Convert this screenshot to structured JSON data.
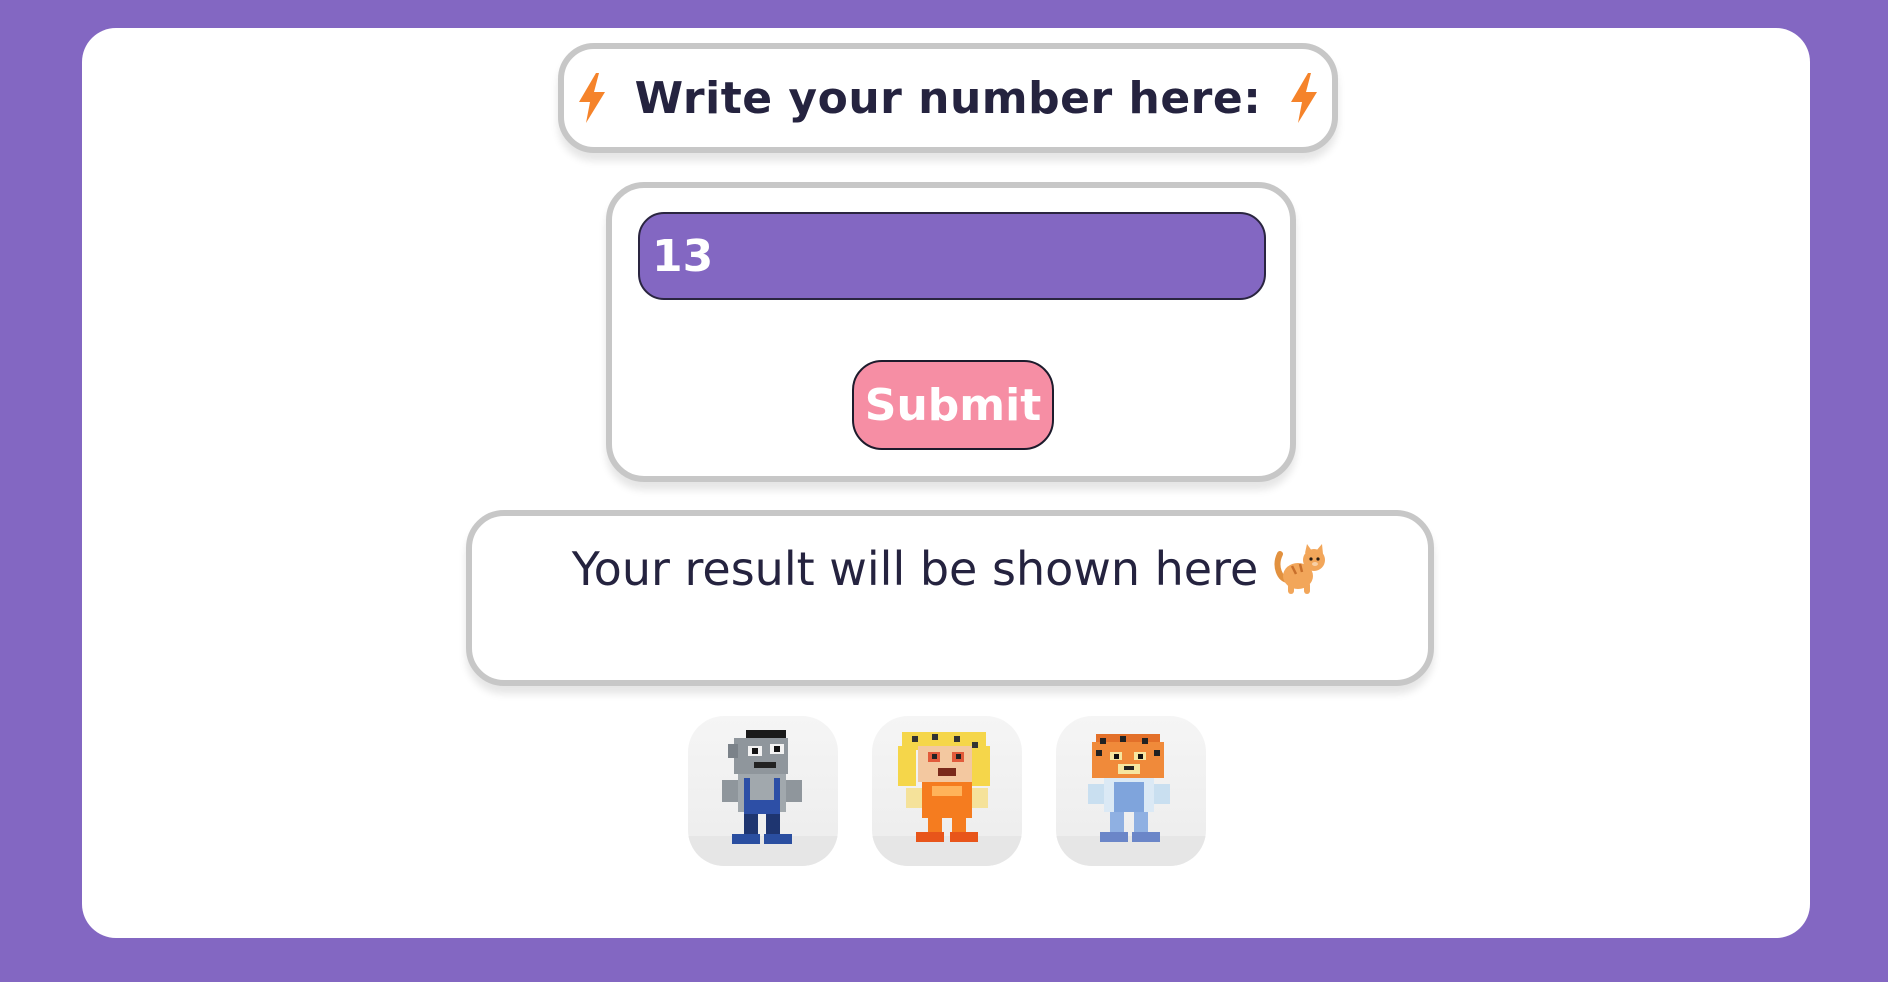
{
  "title": {
    "text": "Write your number here:",
    "left_icon": "lightning-bolt-icon",
    "right_icon": "lightning-bolt-icon"
  },
  "form": {
    "number_value": "13",
    "submit_label": "Submit"
  },
  "result": {
    "text": "Your result will be shown here",
    "icon": "cat-icon"
  },
  "characters": [
    {
      "name": "grey-mouse-character-image"
    },
    {
      "name": "blonde-orange-character-image"
    },
    {
      "name": "tiger-character-image"
    }
  ],
  "colors": {
    "background": "#8367c2",
    "input_background": "#8367c2",
    "submit_background": "#f68ea4",
    "bolt": "#f5832a",
    "text": "#25233f"
  }
}
